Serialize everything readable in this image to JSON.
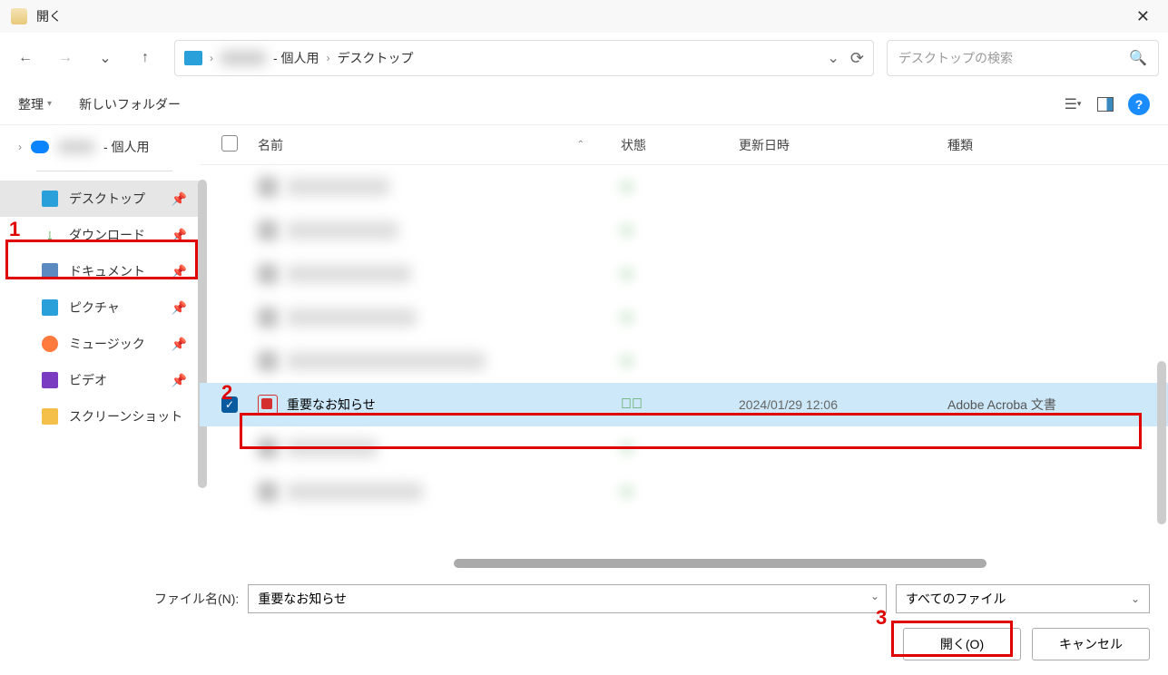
{
  "title": "開く",
  "breadcrumb": {
    "seg1_blurred": true,
    "seg1_suffix": "- 個人用",
    "seg2": "デスクトップ"
  },
  "search": {
    "placeholder": "デスクトップの検索"
  },
  "toolbar": {
    "organize": "整理",
    "new_folder": "新しいフォルダー"
  },
  "tree": {
    "root_suffix": "- 個人用"
  },
  "sidebar": {
    "items": [
      {
        "label": "デスクトップ",
        "icon": "desktop",
        "selected": true
      },
      {
        "label": "ダウンロード",
        "icon": "download"
      },
      {
        "label": "ドキュメント",
        "icon": "doc"
      },
      {
        "label": "ピクチャ",
        "icon": "pic"
      },
      {
        "label": "ミュージック",
        "icon": "music"
      },
      {
        "label": "ビデオ",
        "icon": "video"
      },
      {
        "label": "スクリーンショット",
        "icon": "folder",
        "no_pin": true
      }
    ]
  },
  "columns": {
    "name": "名前",
    "status": "状態",
    "date": "更新日時",
    "type": "種類"
  },
  "files": [
    {
      "blurred": true
    },
    {
      "blurred": true
    },
    {
      "blurred": true
    },
    {
      "blurred": true
    },
    {
      "blurred": true
    },
    {
      "name": "重要なお知らせ",
      "status_ok": true,
      "date": "2024/01/29 12:06",
      "type": "Adobe Acroba 文書",
      "selected": true,
      "checked": true,
      "icon": "pdf"
    },
    {
      "blurred": true
    },
    {
      "blurred": true
    }
  ],
  "footer": {
    "filename_label": "ファイル名(N):",
    "filename_value": "重要なお知らせ",
    "filter": "すべてのファイル",
    "open": "開く(O)",
    "cancel": "キャンセル"
  },
  "annotations": [
    {
      "num": "1",
      "target": "sidebar-desktop"
    },
    {
      "num": "2",
      "target": "file-selected"
    },
    {
      "num": "3",
      "target": "open-button"
    }
  ]
}
